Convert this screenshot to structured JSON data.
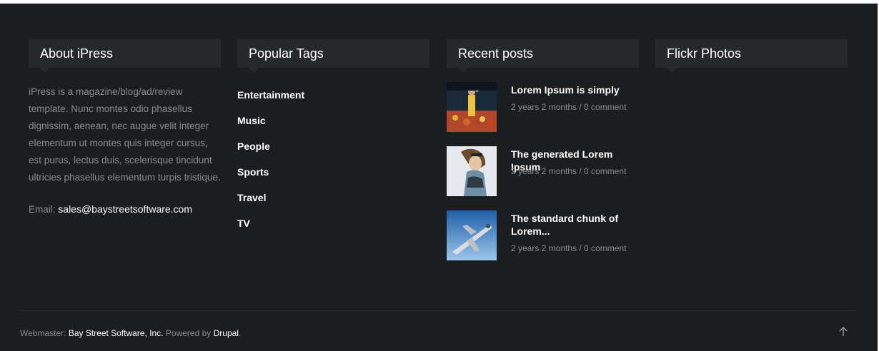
{
  "about": {
    "heading": "About iPress",
    "text": "iPress is a magazine/blog/ad/review template. Nunc montes odio phasellus dignissim, aenean, nec augue velit integer elementum ut montes quis integer cursus, est purus, lectus duis, scelerisque tincidunt ultricies phasellus elementum turpis tristique.",
    "email_label": "Email:",
    "email": "sales@baystreetsoftware.com"
  },
  "tags": {
    "heading": "Popular Tags",
    "items": [
      "Entertainment",
      "Music",
      "People",
      "Sports",
      "Travel",
      "TV"
    ]
  },
  "recent": {
    "heading": "Recent posts",
    "posts": [
      {
        "title": "Lorem Ipsum is simply",
        "meta": "2 years 2 months / 0 comment",
        "thumb": "stadium-concert-photo"
      },
      {
        "title": "The generated Lorem Ipsum",
        "meta": "2 years 2 months / 0 comment",
        "thumb": "woman-portrait-photo"
      },
      {
        "title": "The standard chunk of Lorem...",
        "meta": "2 years 2 months / 0 comment",
        "thumb": "airplane-sky-photo"
      }
    ]
  },
  "flickr": {
    "heading": "Flickr Photos"
  },
  "credits": {
    "webmaster_label": "Webmaster:",
    "webmaster": "Bay Street Software, Inc.",
    "powered_label": "Powered by",
    "powered": "Drupal",
    "end": "."
  },
  "icons": {
    "to_top": "arrow-up-icon"
  },
  "colors": {
    "footer_bg": "#1c1d1f",
    "heading_bg": "#27282b",
    "muted_text": "#8a8b8e",
    "bright_text": "#ffffff"
  }
}
